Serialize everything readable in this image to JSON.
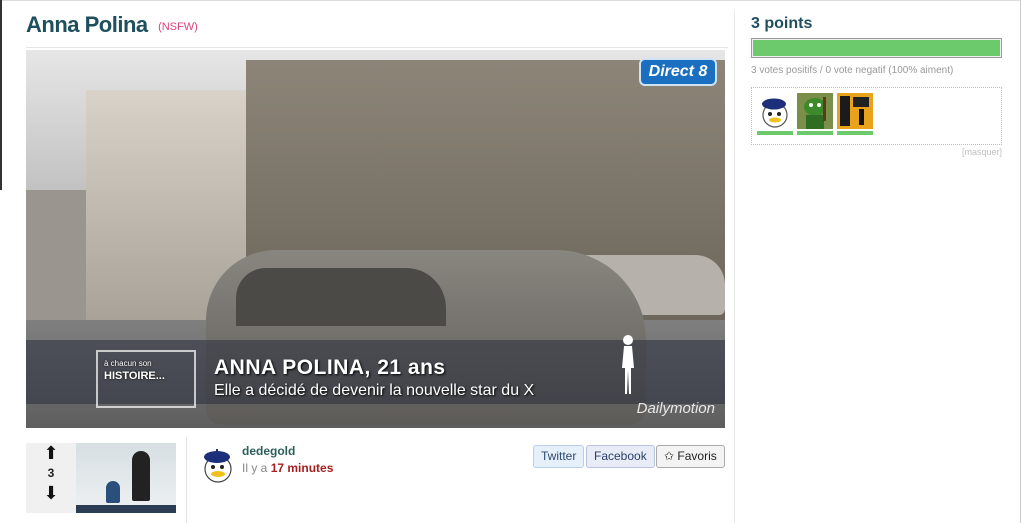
{
  "post": {
    "title": "Anna Polina",
    "nsfw_label": "(NSFW)"
  },
  "video": {
    "channel_logo": "Direct 8",
    "series_line1": "à chacun son",
    "series_line2": "HISTOIRE...",
    "name_caption": "ANNA POLINA, 21 ans",
    "sub_caption": "Elle a décidé de devenir la nouvelle star du X",
    "watermark": "Dailymotion"
  },
  "vote": {
    "up_icon": "arrow-up-icon",
    "down_icon": "arrow-down-icon",
    "count": "3"
  },
  "author": {
    "username": "dedegold",
    "time_prefix": "Il y a",
    "time_value": "17 minutes"
  },
  "share": {
    "twitter_label": "Twitter",
    "facebook_label": "Facebook",
    "favoris_label": "✩ Favoris"
  },
  "sidebar": {
    "points_label": "3 points",
    "rating_fraction": 1.0,
    "votes_summary": "3 votes positifs / 0 vote negatif (100% aiment)",
    "voters": [
      {
        "name": "voter-avatar-1",
        "icon": "beret-penguin-icon"
      },
      {
        "name": "voter-avatar-2",
        "icon": "green-character-icon"
      },
      {
        "name": "voter-avatar-3",
        "icon": "poster-icon"
      }
    ],
    "hide_label": "[masquer]"
  },
  "colors": {
    "title": "#1e4f5f",
    "nsfw": "#e0407a",
    "time_highlight": "#a62020",
    "rating_bar": "#6cc96c"
  }
}
